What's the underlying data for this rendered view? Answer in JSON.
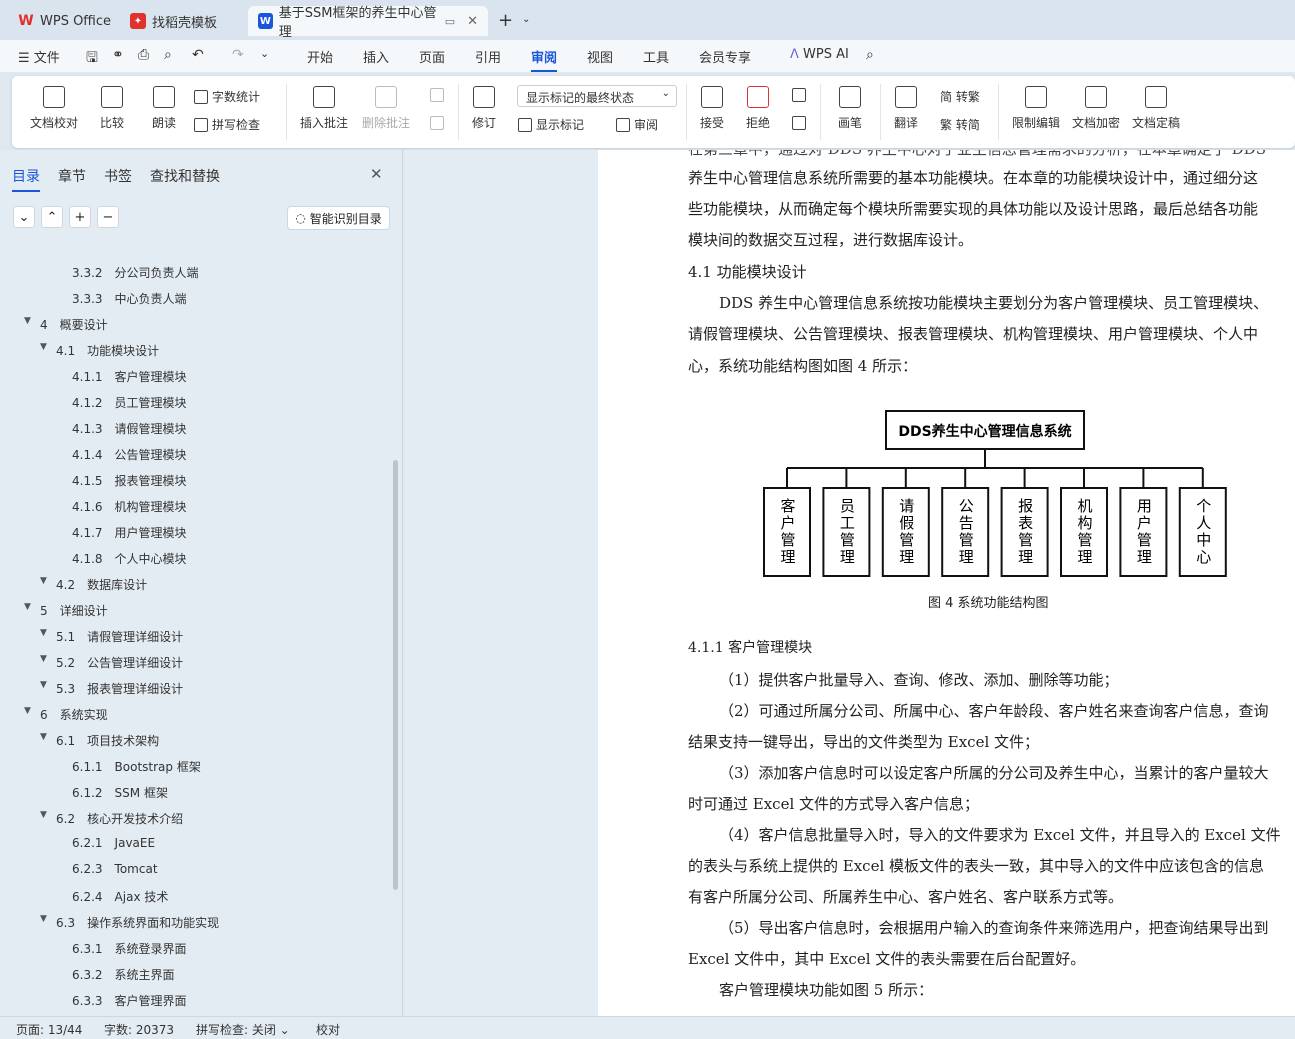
{
  "tabs": [
    {
      "label": "WPS Office"
    },
    {
      "label": "找稻壳模板"
    },
    {
      "label": "基于SSM框架的养生中心管理"
    }
  ],
  "menu": {
    "file": "文件",
    "items": [
      "开始",
      "插入",
      "页面",
      "引用",
      "审阅",
      "视图",
      "工具",
      "会员专享"
    ],
    "ai": "WPS AI"
  },
  "ribbon": {
    "doc_check": "文档校对",
    "compare": "比较",
    "read": "朗读",
    "word_count": "字数统计",
    "spell_check": "拼写检查",
    "insert_comment": "插入批注",
    "delete_comment": "删除批注",
    "track": "修订",
    "markup_state": "显示标记的最终状态",
    "show_markup": "显示标记",
    "review": "审阅",
    "accept": "接受",
    "reject": "拒绝",
    "pen": "画笔",
    "translate": "翻译",
    "to_trad": "简 转繁",
    "to_simp": "繁 转简",
    "restrict": "限制编辑",
    "encrypt": "文档加密",
    "finalize": "文档定稿"
  },
  "sidebar": {
    "tabs": [
      "目录",
      "章节",
      "书签",
      "查找和替换"
    ],
    "smart_toc": "智能识别目录",
    "toc": [
      {
        "num": "3.3.2",
        "text": "分公司负责人端",
        "level": 3
      },
      {
        "num": "3.3.3",
        "text": "中心负责人端",
        "level": 3
      },
      {
        "num": "4",
        "text": "概要设计",
        "level": 1
      },
      {
        "num": "4.1",
        "text": "功能模块设计",
        "level": 2
      },
      {
        "num": "4.1.1",
        "text": "客户管理模块",
        "level": 3
      },
      {
        "num": "4.1.2",
        "text": "员工管理模块",
        "level": 3
      },
      {
        "num": "4.1.3",
        "text": "请假管理模块",
        "level": 3
      },
      {
        "num": "4.1.4",
        "text": "公告管理模块",
        "level": 3
      },
      {
        "num": "4.1.5",
        "text": "报表管理模块",
        "level": 3
      },
      {
        "num": "4.1.6",
        "text": "机构管理模块",
        "level": 3
      },
      {
        "num": "4.1.7",
        "text": "用户管理模块",
        "level": 3
      },
      {
        "num": "4.1.8",
        "text": "个人中心模块",
        "level": 3
      },
      {
        "num": "4.2",
        "text": "数据库设计",
        "level": 2
      },
      {
        "num": "5",
        "text": "详细设计",
        "level": 1
      },
      {
        "num": "5.1",
        "text": "请假管理详细设计",
        "level": 2
      },
      {
        "num": "5.2",
        "text": "公告管理详细设计",
        "level": 2
      },
      {
        "num": "5.3",
        "text": "报表管理详细设计",
        "level": 2
      },
      {
        "num": "6",
        "text": "系统实现",
        "level": 1
      },
      {
        "num": "6.1",
        "text": "项目技术架构",
        "level": 2
      },
      {
        "num": "6.1.1",
        "text": "Bootstrap 框架",
        "level": 3
      },
      {
        "num": "6.1.2",
        "text": "SSM 框架",
        "level": 3
      },
      {
        "num": "6.2",
        "text": "核心开发技术介绍",
        "level": 2
      },
      {
        "num": "6.2.1",
        "text": "JavaEE",
        "level": 3
      },
      {
        "num": "6.2.3",
        "text": "Tomcat",
        "level": 3
      },
      {
        "num": "6.2.4",
        "text": "Ajax 技术",
        "level": 3
      },
      {
        "num": "6.3",
        "text": "操作系统界面和功能实现",
        "level": 2
      },
      {
        "num": "6.3.1",
        "text": "系统登录界面",
        "level": 3
      },
      {
        "num": "6.3.2",
        "text": "系统主界面",
        "level": 3
      },
      {
        "num": "6.3.3",
        "text": "客户管理界面",
        "level": 3
      }
    ]
  },
  "doc": {
    "lines_top": [
      "养生中心管理信息系统所需要的基本功能模块。在本章的功能模块设计中，通过细分这",
      "些功能模块，从而确定每个模块所需要实现的具体功能以及设计思路，最后总结各功能",
      "模块间的数据交互过程，进行数据库设计。"
    ],
    "heading_41": "4.1   功能模块设计",
    "para_41": [
      "DDS 养生中心管理信息系统按功能模块主要划分为客户管理模块、员工管理模块、",
      "请假管理模块、公告管理模块、报表管理模块、机构管理模块、用户管理模块、个人中",
      "心，系统功能结构图如图 4 所示："
    ],
    "diagram": {
      "root": "DDS养生中心管理信息系统",
      "children": [
        "客户管理",
        "员工管理",
        "请假管理",
        "公告管理",
        "报表管理",
        "机构管理",
        "用户管理",
        "个人中心"
      ],
      "caption": "图 4    系统功能结构图"
    },
    "heading_411": "4.1.1    客户管理模块",
    "para_411": [
      "（1）提供客户批量导入、查询、修改、添加、删除等功能；",
      "（2）可通过所属分公司、所属中心、客户年龄段、客户姓名来查询客户信息，查询",
      "结果支持一键导出，导出的文件类型为 Excel 文件；",
      "（3）添加客户信息时可以设定客户所属的分公司及养生中心，当累计的客户量较大",
      "时可通过 Excel 文件的方式导入客户信息；",
      "（4）客户信息批量导入时，导入的文件要求为 Excel 文件，并且导入的 Excel 文件",
      "的表头与系统上提供的 Excel 模板文件的表头一致，其中导入的文件中应该包含的信息",
      "有客户所属分公司、所属养生中心、客户姓名、客户联系方式等。",
      "（5）导出客户信息时，会根据用户输入的查询条件来筛选用户，把查询结果导出到",
      "Excel 文件中，其中 Excel 文件的表头需要在后台配置好。",
      "客户管理模块功能如图 5 所示："
    ]
  },
  "status": {
    "page": "页面: 13/44",
    "words": "字数: 20373",
    "spell": "拼写检查: 关闭",
    "proof": "校对"
  },
  "colors": {
    "accent": "#1a56db",
    "wps_red": "#e0312c"
  }
}
